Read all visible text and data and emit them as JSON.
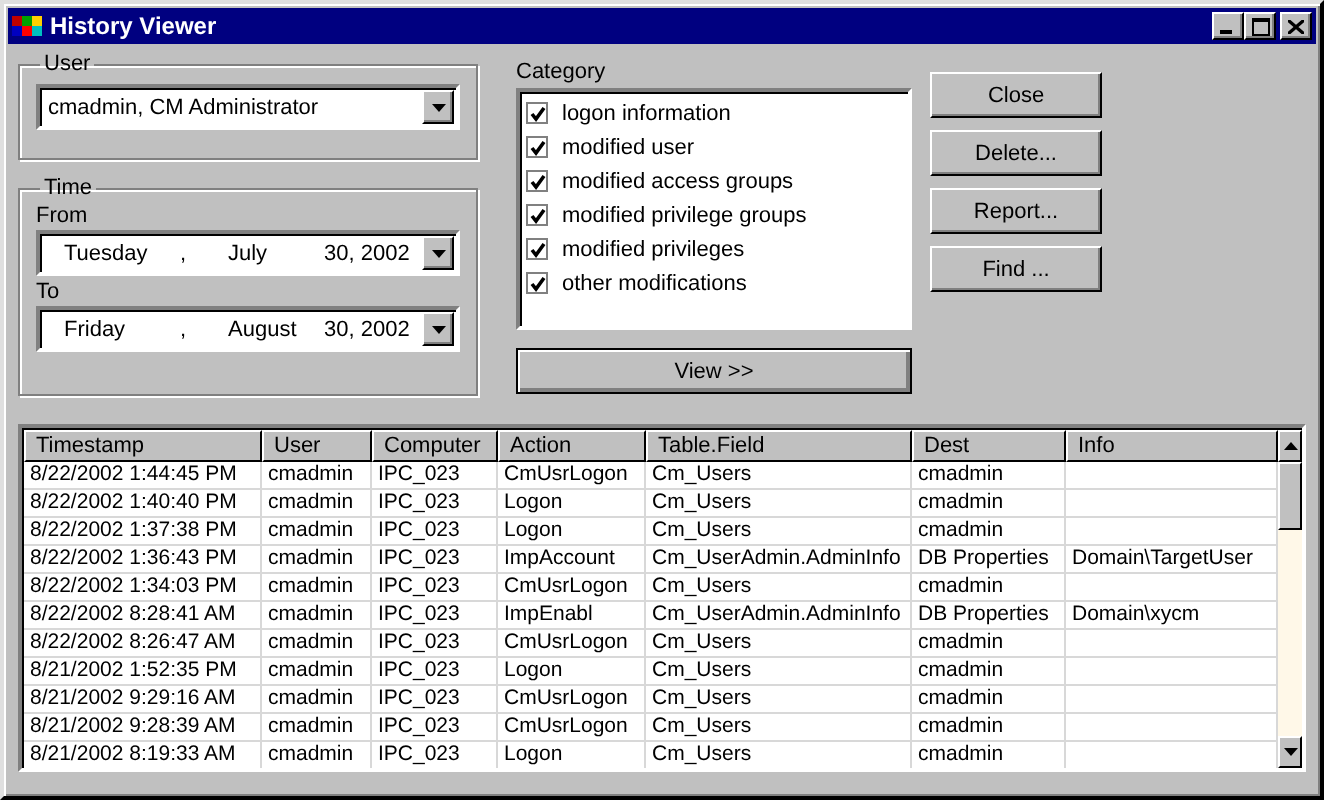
{
  "window": {
    "title": "History Viewer"
  },
  "user": {
    "label": "User",
    "value": "cmadmin, CM Administrator"
  },
  "time": {
    "label": "Time",
    "from_label": "From",
    "from": {
      "weekday": "Tuesday",
      "separator": ",",
      "month": "July",
      "day_year": "30, 2002"
    },
    "to_label": "To",
    "to": {
      "weekday": "Friday",
      "separator": ",",
      "month": "August",
      "day_year": "30, 2002"
    }
  },
  "category": {
    "label": "Category",
    "items": [
      {
        "label": "logon information",
        "checked": true
      },
      {
        "label": "modified user",
        "checked": true
      },
      {
        "label": "modified access groups",
        "checked": true
      },
      {
        "label": "modified privilege groups",
        "checked": true
      },
      {
        "label": "modified privileges",
        "checked": true
      },
      {
        "label": "other modifications",
        "checked": true
      }
    ]
  },
  "buttons": [
    "Close",
    "Delete...",
    "Report...",
    "Find ..."
  ],
  "view_button": "View >>",
  "table": {
    "columns": [
      "Timestamp",
      "User",
      "Computer",
      "Action",
      "Table.Field",
      "Dest",
      "Info"
    ],
    "rows": [
      [
        "8/22/2002 1:44:45 PM",
        "cmadmin",
        "IPC_023",
        "CmUsrLogon",
        "Cm_Users",
        "cmadmin",
        ""
      ],
      [
        "8/22/2002 1:40:40 PM",
        "cmadmin",
        "IPC_023",
        "Logon",
        "Cm_Users",
        "cmadmin",
        ""
      ],
      [
        "8/22/2002 1:37:38 PM",
        "cmadmin",
        "IPC_023",
        "Logon",
        "Cm_Users",
        "cmadmin",
        ""
      ],
      [
        "8/22/2002 1:36:43 PM",
        "cmadmin",
        "IPC_023",
        "ImpAccount",
        "Cm_UserAdmin.AdminInfo",
        "DB Properties",
        "Domain\\TargetUser"
      ],
      [
        "8/22/2002 1:34:03 PM",
        "cmadmin",
        "IPC_023",
        "CmUsrLogon",
        "Cm_Users",
        "cmadmin",
        ""
      ],
      [
        "8/22/2002 8:28:41 AM",
        "cmadmin",
        "IPC_023",
        "ImpEnabl",
        "Cm_UserAdmin.AdminInfo",
        "DB Properties",
        "Domain\\xycm"
      ],
      [
        "8/22/2002 8:26:47 AM",
        "cmadmin",
        "IPC_023",
        "CmUsrLogon",
        "Cm_Users",
        "cmadmin",
        ""
      ],
      [
        "8/21/2002 1:52:35 PM",
        "cmadmin",
        "IPC_023",
        "Logon",
        "Cm_Users",
        "cmadmin",
        ""
      ],
      [
        "8/21/2002 9:29:16 AM",
        "cmadmin",
        "IPC_023",
        "CmUsrLogon",
        "Cm_Users",
        "cmadmin",
        ""
      ],
      [
        "8/21/2002 9:28:39 AM",
        "cmadmin",
        "IPC_023",
        "CmUsrLogon",
        "Cm_Users",
        "cmadmin",
        ""
      ],
      [
        "8/21/2002 8:19:33 AM",
        "cmadmin",
        "IPC_023",
        "Logon",
        "Cm_Users",
        "cmadmin",
        ""
      ]
    ]
  }
}
